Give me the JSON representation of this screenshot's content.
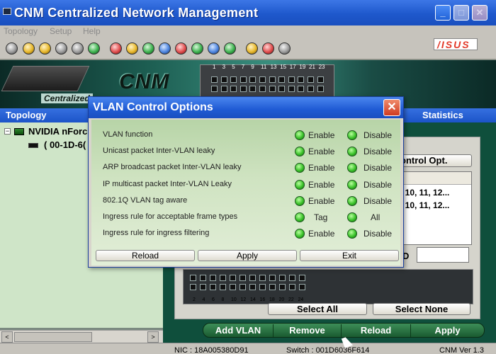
{
  "window": {
    "title": "CNM  Centralized Network Management",
    "min_glyph": "_",
    "max_glyph": "□",
    "close_glyph": "✕"
  },
  "menu": {
    "items": [
      "Topology",
      "Setup",
      "Help"
    ]
  },
  "toolbar": {
    "icons": [
      "power-icon",
      "smiley-icon",
      "hub-icon",
      "switch-icon",
      "eye-icon",
      "gear-icon",
      "cross-icon",
      "key-icon",
      "globe-icon",
      "monitor-icon",
      "phone-icon",
      "globe-arrow-icon",
      "refresh-icon",
      "log-icon",
      "document-icon",
      "person-icon",
      "user-icon"
    ]
  },
  "brand": {
    "logo_text": "/ISUS"
  },
  "banner": {
    "logo": "CNM",
    "tagline": "Centralized",
    "top_ports": [
      "1",
      "3",
      "5",
      "7",
      "9",
      "11",
      "13",
      "15",
      "17",
      "19",
      "21",
      "23"
    ],
    "panel_brand": "ASUS"
  },
  "topology": {
    "header": "Topology",
    "root_label": "NVIDIA nForc",
    "child_label": "( 00-1D-6(",
    "scroll_left": "<",
    "scroll_right": ">"
  },
  "statistics": {
    "header": "Statistics",
    "control_opt_label": "ontrol Opt.",
    "vlan_rows": [
      ", 10, 11, 12...",
      ", 10, 11, 12..."
    ],
    "vid_label": "D",
    "bottom_ports": [
      "2",
      "4",
      "6",
      "8",
      "10",
      "12",
      "14",
      "16",
      "18",
      "20",
      "22",
      "24"
    ],
    "select_all": "Select All",
    "select_none": "Select None",
    "actions": [
      "Add VLAN",
      "Remove",
      "Reload",
      "Apply"
    ]
  },
  "status": {
    "nic": "NIC : 18A005380D91",
    "switch": "Switch : 001D6036F614",
    "version": "CNM Ver 1.3"
  },
  "dialog": {
    "title": "VLAN Control Options",
    "close_glyph": "✕",
    "options": [
      {
        "label": "VLAN function",
        "a": "Enable",
        "b": "Disable"
      },
      {
        "label": "Unicast packet Inter-VLAN leaky",
        "a": "Enable",
        "b": "Disable"
      },
      {
        "label": "ARP broadcast packet Inter-VLAN leaky",
        "a": "Enable",
        "b": "Disable"
      },
      {
        "label": "IP multicast packet Inter-VLAN Leaky",
        "a": "Enable",
        "b": "Disable"
      },
      {
        "label": "802.1Q VLAN tag aware",
        "a": "Enable",
        "b": "Disable"
      },
      {
        "label": "Ingress rule for acceptable frame types",
        "a": "Tag",
        "b": "All"
      },
      {
        "label": "Ingress rule for ingress filtering",
        "a": "Enable",
        "b": "Disable"
      }
    ],
    "buttons": [
      "Reload",
      "Apply",
      "Exit"
    ]
  },
  "colors": {
    "titlebar_blue": "#1e58cc",
    "dialog_close_red": "#cf3b22",
    "radio_green": "#3bc22a",
    "tree_bg": "#cfe5c8"
  }
}
